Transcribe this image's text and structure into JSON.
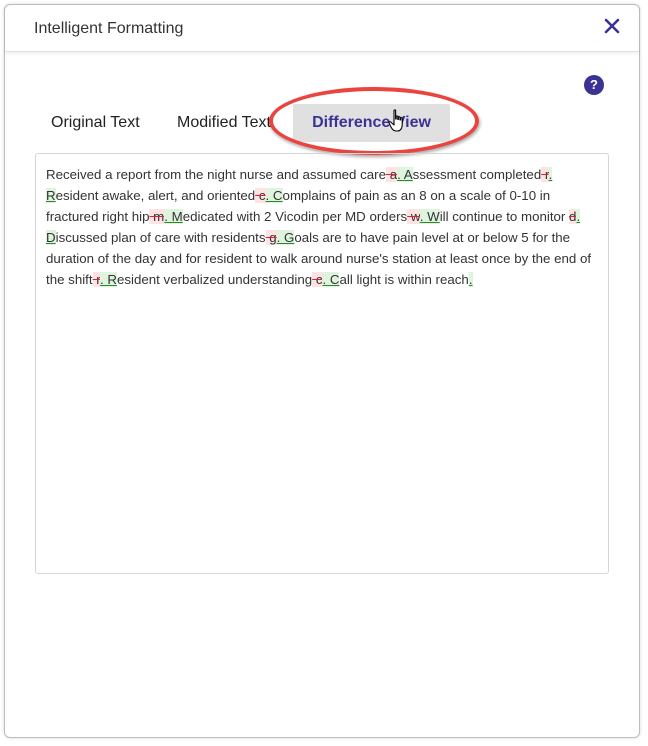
{
  "dialog": {
    "title": "Intelligent Formatting",
    "close_icon": "close-icon",
    "help_label": "?"
  },
  "tabs": [
    {
      "label": "Original Text",
      "active": false
    },
    {
      "label": "Modified Text",
      "active": false
    },
    {
      "label": "Difference View",
      "active": true
    }
  ],
  "colors": {
    "accent": "#3b3393",
    "active_tab_bg": "#e0e0e0",
    "highlight_ring": "#e9443f",
    "deletion": "#fde3e3",
    "insertion": "#dff4df"
  },
  "diff": [
    {
      "t": "Received a report from the night nurse and assumed care"
    },
    {
      "d": " a"
    },
    {
      "i": ". A"
    },
    {
      "t": "ssessment completed"
    },
    {
      "d": " r"
    },
    {
      "i": "."
    },
    {
      "t": " "
    },
    {
      "i": "R"
    },
    {
      "t": "esident awake, alert, and oriented"
    },
    {
      "d": " c"
    },
    {
      "i": ". C"
    },
    {
      "t": "omplains of pain as an 8 on a scale of 0-10 in fractured right hip"
    },
    {
      "d": " m"
    },
    {
      "i": ". M"
    },
    {
      "t": "edicated with 2 Vicodin per MD orders"
    },
    {
      "d": " w"
    },
    {
      "i": ". W"
    },
    {
      "t": "ill continue to monitor "
    },
    {
      "d": "d"
    },
    {
      "i": ". D"
    },
    {
      "t": "iscussed plan of care with residents"
    },
    {
      "d": " g"
    },
    {
      "i": ". G"
    },
    {
      "t": "oals are to have pain level at or below 5 for the duration of the day and for resident to walk around nurse's station at least once by the end of the shift"
    },
    {
      "d": " r"
    },
    {
      "i": ". R"
    },
    {
      "t": "esident verbalized understanding"
    },
    {
      "d": " c"
    },
    {
      "i": ". C"
    },
    {
      "t": "all light is within reach"
    },
    {
      "i": "."
    }
  ]
}
